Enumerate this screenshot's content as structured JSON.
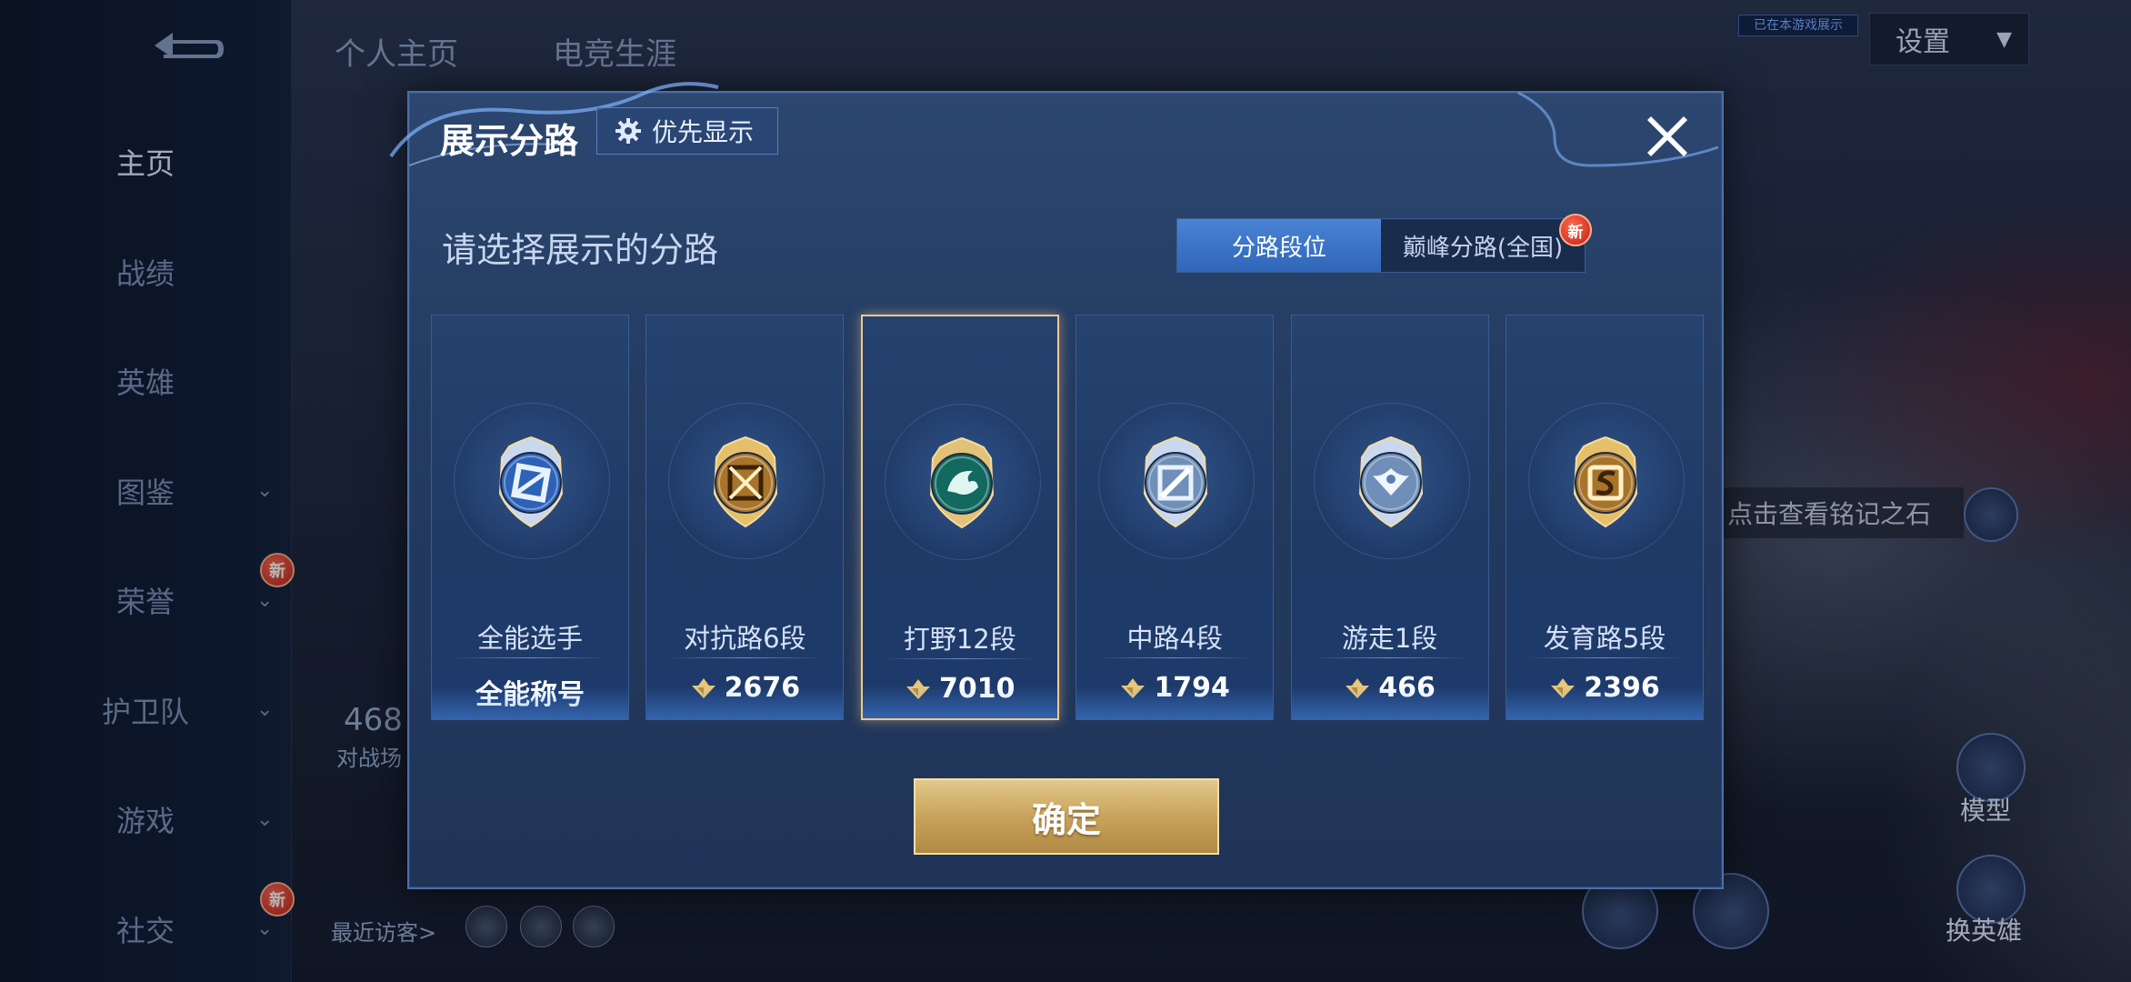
{
  "nav": {
    "items": [
      {
        "label": "主页",
        "active": true,
        "chevron": false,
        "new": false
      },
      {
        "label": "战绩",
        "active": false,
        "chevron": false,
        "new": false
      },
      {
        "label": "英雄",
        "active": false,
        "chevron": false,
        "new": false
      },
      {
        "label": "图鉴",
        "active": false,
        "chevron": true,
        "new": false
      },
      {
        "label": "荣誉",
        "active": false,
        "chevron": true,
        "new": true
      },
      {
        "label": "护卫队",
        "active": false,
        "chevron": true,
        "new": false
      },
      {
        "label": "游戏",
        "active": false,
        "chevron": true,
        "new": false
      },
      {
        "label": "社交",
        "active": false,
        "chevron": true,
        "new": true
      }
    ],
    "new_badge": "新",
    "chevron": "⌄"
  },
  "header": {
    "tabs": [
      "个人主页",
      "电竞生涯"
    ],
    "settings_label": "设置",
    "notice_tag": "已在本游戏展示"
  },
  "background": {
    "inscription_label": "点击查看铭记之石",
    "model_label": "模型",
    "switch_hero_label": "换英雄",
    "stat_value": "468",
    "stat_label": "对战场",
    "recent_visitors": "最近访客>"
  },
  "modal": {
    "title": "展示分路",
    "priority_label": "优先显示",
    "prompt": "请选择展示的分路",
    "tabs": [
      {
        "label": "分路段位",
        "active": true
      },
      {
        "label": "巅峰分路(全国)",
        "active": false,
        "new": true
      }
    ],
    "cards": [
      {
        "name": "全能选手",
        "value": "全能称号",
        "has_icon": false,
        "emblem": "allround-emblem",
        "color": "#3a7ad8"
      },
      {
        "name": "对抗路6段",
        "value": "2676",
        "has_icon": true,
        "emblem": "clash-lane-emblem",
        "color": "#d9a84a"
      },
      {
        "name": "打野12段",
        "value": "7010",
        "has_icon": true,
        "emblem": "jungle-emblem",
        "color": "#1f8a7a",
        "selected": true
      },
      {
        "name": "中路4段",
        "value": "1794",
        "has_icon": true,
        "emblem": "mid-lane-emblem",
        "color": "#8fb0d6"
      },
      {
        "name": "游走1段",
        "value": "466",
        "has_icon": true,
        "emblem": "roam-emblem",
        "color": "#8fb0d6"
      },
      {
        "name": "发育路5段",
        "value": "2396",
        "has_icon": true,
        "emblem": "farm-lane-emblem",
        "color": "#d9a84a"
      }
    ],
    "confirm_label": "确定"
  },
  "colors": {
    "accent": "#3f78c8",
    "gold": "#f0c88a",
    "modal_bg": "#243b60"
  }
}
